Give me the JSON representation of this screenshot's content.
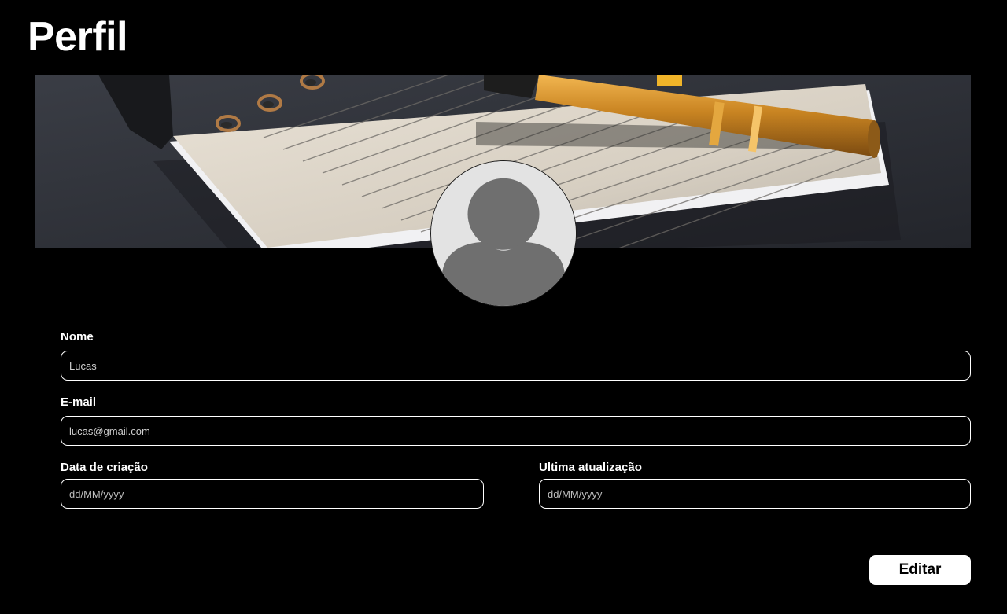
{
  "page": {
    "title": "Perfil"
  },
  "banner": {
    "image": "notebook-with-pen-photo"
  },
  "avatar": {
    "icon": "user-silhouette-icon"
  },
  "form": {
    "name": {
      "label": "Nome",
      "value": "Lucas"
    },
    "email": {
      "label": "E-mail",
      "value": "lucas@gmail.com"
    },
    "created": {
      "label": "Data de criação",
      "placeholder": "dd/MM/yyyy"
    },
    "updated": {
      "label": "Ultima atualização",
      "placeholder": "dd/MM/yyyy"
    }
  },
  "actions": {
    "edit_label": "Editar"
  },
  "colors": {
    "background": "#000000",
    "text": "#ffffff",
    "button_bg": "#ffffff",
    "button_text": "#000000",
    "avatar_bg": "#e3e3e3",
    "avatar_figure": "#6f6f6f"
  }
}
